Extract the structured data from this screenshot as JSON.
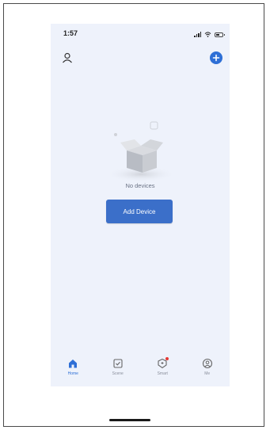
{
  "status_bar": {
    "time": "1:57"
  },
  "header": {
    "profile_icon": "person-icon",
    "add_icon": "plus-circle-icon"
  },
  "main": {
    "empty_message": "No devices",
    "add_device_label": "Add Device"
  },
  "tabbar": {
    "items": [
      {
        "label": "Home",
        "icon": "home-icon",
        "active": true
      },
      {
        "label": "Scene",
        "icon": "checkbox-icon",
        "active": false
      },
      {
        "label": "Smart",
        "icon": "shield-icon",
        "active": false,
        "badge": true
      },
      {
        "label": "Me",
        "icon": "user-circle-icon",
        "active": false
      }
    ]
  },
  "colors": {
    "accent": "#2e6fd6",
    "button": "#3b6fc9",
    "background": "#eef2fb",
    "badge": "#e53935"
  }
}
